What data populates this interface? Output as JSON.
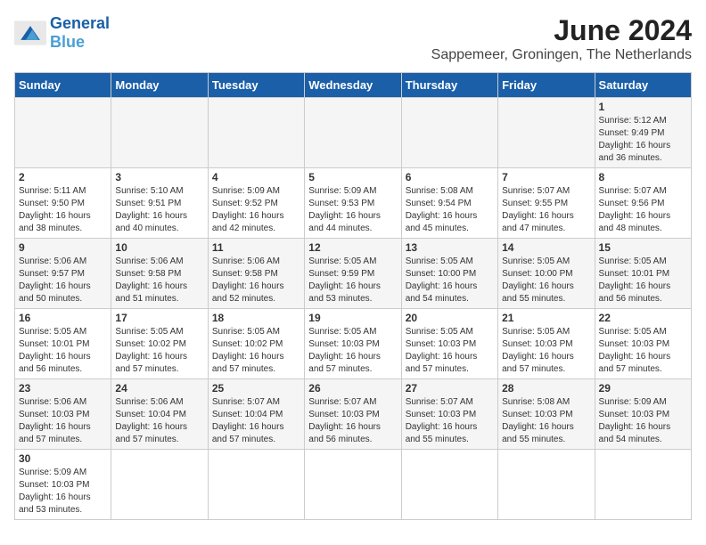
{
  "header": {
    "logo_general": "General",
    "logo_blue": "Blue",
    "month_year": "June 2024",
    "location": "Sappemeer, Groningen, The Netherlands"
  },
  "weekdays": [
    "Sunday",
    "Monday",
    "Tuesday",
    "Wednesday",
    "Thursday",
    "Friday",
    "Saturday"
  ],
  "weeks": [
    [
      {
        "day": "",
        "info": ""
      },
      {
        "day": "",
        "info": ""
      },
      {
        "day": "",
        "info": ""
      },
      {
        "day": "",
        "info": ""
      },
      {
        "day": "",
        "info": ""
      },
      {
        "day": "",
        "info": ""
      },
      {
        "day": "1",
        "info": "Sunrise: 5:12 AM\nSunset: 9:49 PM\nDaylight: 16 hours\nand 36 minutes."
      }
    ],
    [
      {
        "day": "2",
        "info": "Sunrise: 5:11 AM\nSunset: 9:50 PM\nDaylight: 16 hours\nand 38 minutes."
      },
      {
        "day": "3",
        "info": "Sunrise: 5:10 AM\nSunset: 9:51 PM\nDaylight: 16 hours\nand 40 minutes."
      },
      {
        "day": "4",
        "info": "Sunrise: 5:09 AM\nSunset: 9:52 PM\nDaylight: 16 hours\nand 42 minutes."
      },
      {
        "day": "5",
        "info": "Sunrise: 5:09 AM\nSunset: 9:53 PM\nDaylight: 16 hours\nand 44 minutes."
      },
      {
        "day": "6",
        "info": "Sunrise: 5:08 AM\nSunset: 9:54 PM\nDaylight: 16 hours\nand 45 minutes."
      },
      {
        "day": "7",
        "info": "Sunrise: 5:07 AM\nSunset: 9:55 PM\nDaylight: 16 hours\nand 47 minutes."
      },
      {
        "day": "8",
        "info": "Sunrise: 5:07 AM\nSunset: 9:56 PM\nDaylight: 16 hours\nand 48 minutes."
      }
    ],
    [
      {
        "day": "9",
        "info": "Sunrise: 5:06 AM\nSunset: 9:57 PM\nDaylight: 16 hours\nand 50 minutes."
      },
      {
        "day": "10",
        "info": "Sunrise: 5:06 AM\nSunset: 9:58 PM\nDaylight: 16 hours\nand 51 minutes."
      },
      {
        "day": "11",
        "info": "Sunrise: 5:06 AM\nSunset: 9:58 PM\nDaylight: 16 hours\nand 52 minutes."
      },
      {
        "day": "12",
        "info": "Sunrise: 5:05 AM\nSunset: 9:59 PM\nDaylight: 16 hours\nand 53 minutes."
      },
      {
        "day": "13",
        "info": "Sunrise: 5:05 AM\nSunset: 10:00 PM\nDaylight: 16 hours\nand 54 minutes."
      },
      {
        "day": "14",
        "info": "Sunrise: 5:05 AM\nSunset: 10:00 PM\nDaylight: 16 hours\nand 55 minutes."
      },
      {
        "day": "15",
        "info": "Sunrise: 5:05 AM\nSunset: 10:01 PM\nDaylight: 16 hours\nand 56 minutes."
      }
    ],
    [
      {
        "day": "16",
        "info": "Sunrise: 5:05 AM\nSunset: 10:01 PM\nDaylight: 16 hours\nand 56 minutes."
      },
      {
        "day": "17",
        "info": "Sunrise: 5:05 AM\nSunset: 10:02 PM\nDaylight: 16 hours\nand 57 minutes."
      },
      {
        "day": "18",
        "info": "Sunrise: 5:05 AM\nSunset: 10:02 PM\nDaylight: 16 hours\nand 57 minutes."
      },
      {
        "day": "19",
        "info": "Sunrise: 5:05 AM\nSunset: 10:03 PM\nDaylight: 16 hours\nand 57 minutes."
      },
      {
        "day": "20",
        "info": "Sunrise: 5:05 AM\nSunset: 10:03 PM\nDaylight: 16 hours\nand 57 minutes."
      },
      {
        "day": "21",
        "info": "Sunrise: 5:05 AM\nSunset: 10:03 PM\nDaylight: 16 hours\nand 57 minutes."
      },
      {
        "day": "22",
        "info": "Sunrise: 5:05 AM\nSunset: 10:03 PM\nDaylight: 16 hours\nand 57 minutes."
      }
    ],
    [
      {
        "day": "23",
        "info": "Sunrise: 5:06 AM\nSunset: 10:03 PM\nDaylight: 16 hours\nand 57 minutes."
      },
      {
        "day": "24",
        "info": "Sunrise: 5:06 AM\nSunset: 10:04 PM\nDaylight: 16 hours\nand 57 minutes."
      },
      {
        "day": "25",
        "info": "Sunrise: 5:07 AM\nSunset: 10:04 PM\nDaylight: 16 hours\nand 57 minutes."
      },
      {
        "day": "26",
        "info": "Sunrise: 5:07 AM\nSunset: 10:03 PM\nDaylight: 16 hours\nand 56 minutes."
      },
      {
        "day": "27",
        "info": "Sunrise: 5:07 AM\nSunset: 10:03 PM\nDaylight: 16 hours\nand 55 minutes."
      },
      {
        "day": "28",
        "info": "Sunrise: 5:08 AM\nSunset: 10:03 PM\nDaylight: 16 hours\nand 55 minutes."
      },
      {
        "day": "29",
        "info": "Sunrise: 5:09 AM\nSunset: 10:03 PM\nDaylight: 16 hours\nand 54 minutes."
      }
    ],
    [
      {
        "day": "30",
        "info": "Sunrise: 5:09 AM\nSunset: 10:03 PM\nDaylight: 16 hours\nand 53 minutes."
      },
      {
        "day": "",
        "info": ""
      },
      {
        "day": "",
        "info": ""
      },
      {
        "day": "",
        "info": ""
      },
      {
        "day": "",
        "info": ""
      },
      {
        "day": "",
        "info": ""
      },
      {
        "day": "",
        "info": ""
      }
    ]
  ]
}
